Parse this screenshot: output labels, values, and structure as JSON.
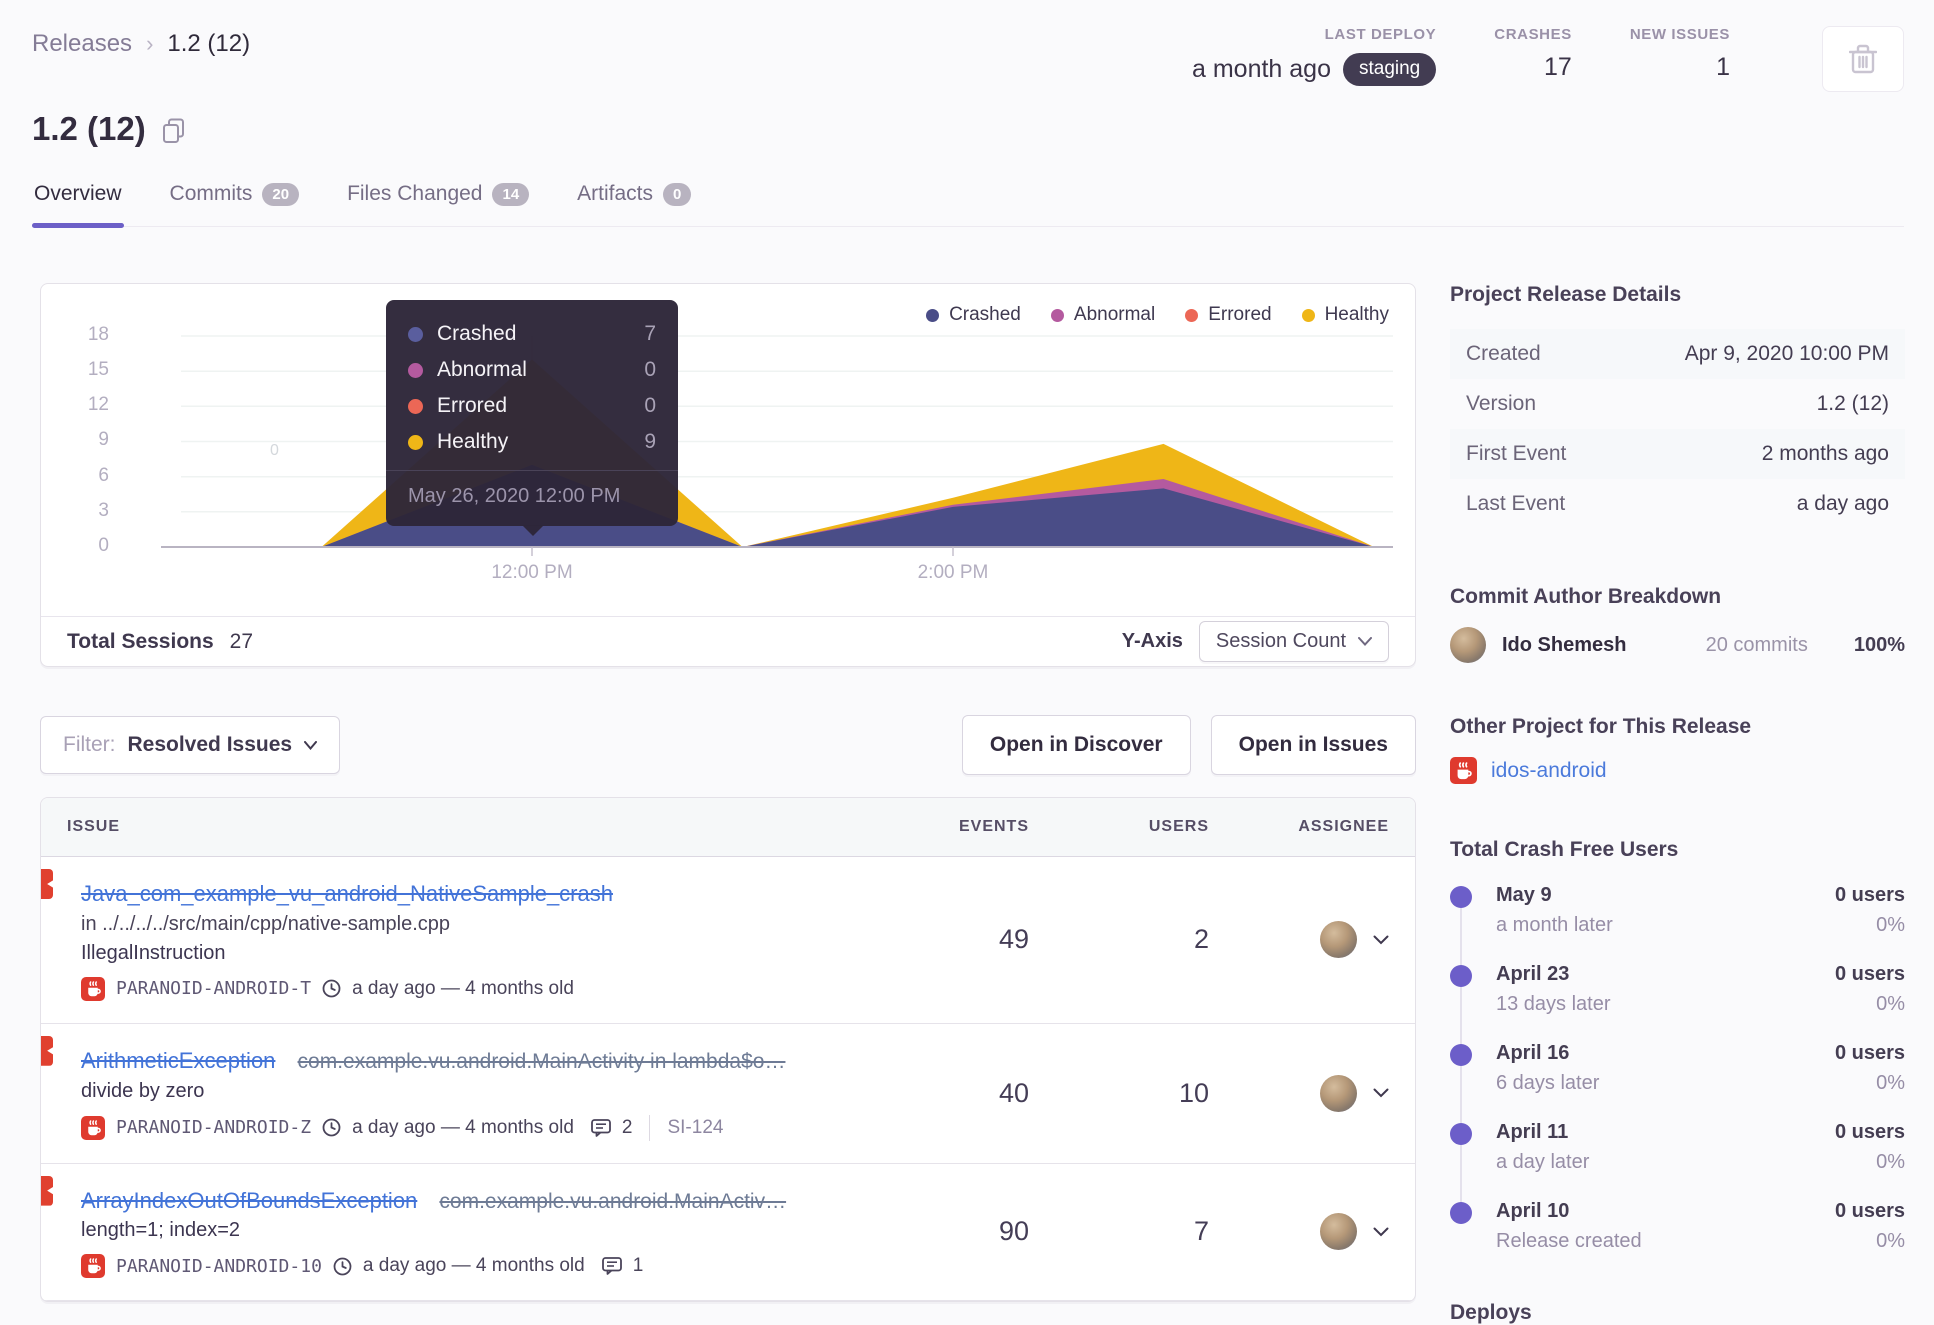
{
  "breadcrumb": {
    "parent": "Releases",
    "current": "1.2 (12)"
  },
  "header": {
    "stats": [
      {
        "label": "LAST DEPLOY",
        "value": "a month ago",
        "badge": "staging"
      },
      {
        "label": "CRASHES",
        "value": "17"
      },
      {
        "label": "NEW ISSUES",
        "value": "1"
      }
    ]
  },
  "release": {
    "title": "1.2 (12)"
  },
  "tabs": [
    {
      "label": "Overview"
    },
    {
      "label": "Commits",
      "badge": "20"
    },
    {
      "label": "Files Changed",
      "badge": "14"
    },
    {
      "label": "Artifacts",
      "badge": "0"
    }
  ],
  "chart": {
    "legend": [
      {
        "label": "Crashed",
        "color": "#4a4d87"
      },
      {
        "label": "Abnormal",
        "color": "#b45a9f"
      },
      {
        "label": "Errored",
        "color": "#ec6756"
      },
      {
        "label": "Healthy",
        "color": "#efb617"
      }
    ],
    "tooltip": {
      "rows": [
        {
          "label": "Crashed",
          "value": "7"
        },
        {
          "label": "Abnormal",
          "value": "0"
        },
        {
          "label": "Errored",
          "value": "0"
        },
        {
          "label": "Healthy",
          "value": "9"
        }
      ],
      "date": "May 26, 2020 12:00 PM"
    },
    "y_ticks": [
      "18",
      "15",
      "12",
      "9",
      "6",
      "3",
      "0"
    ],
    "x_ticks": [
      "12:00 PM",
      "2:00 PM"
    ],
    "stray_label": "0",
    "footer": {
      "total_label": "Total Sessions",
      "total_value": "27",
      "y_axis_label": "Y-Axis",
      "y_axis_value": "Session Count"
    }
  },
  "chart_data": {
    "type": "area",
    "stacked": true,
    "x": [
      "11:00 AM",
      "12:00 PM",
      "1:00 PM",
      "2:00 PM",
      "3:00 PM",
      "4:00 PM"
    ],
    "x_axis_ticks": [
      "12:00 PM",
      "2:00 PM"
    ],
    "series": [
      {
        "name": "Crashed",
        "color": "#4a4d87",
        "values": [
          0,
          7,
          0,
          2,
          5,
          0
        ]
      },
      {
        "name": "Abnormal",
        "color": "#b45a9f",
        "values": [
          0,
          0,
          0,
          0,
          1,
          0
        ]
      },
      {
        "name": "Errored",
        "color": "#ec6756",
        "values": [
          0,
          0,
          0,
          0,
          0,
          0
        ]
      },
      {
        "name": "Healthy",
        "color": "#efb617",
        "values": [
          0,
          9,
          0,
          2,
          3,
          0
        ]
      }
    ],
    "ylim": [
      0,
      18
    ],
    "y_ticks": [
      0,
      3,
      6,
      9,
      12,
      15,
      18
    ],
    "grid": true,
    "legend_position": "top-right",
    "tooltip_point": {
      "date": "May 26, 2020 12:00 PM",
      "Crashed": 7,
      "Abnormal": 0,
      "Errored": 0,
      "Healthy": 9
    },
    "total_sessions": 27,
    "y_axis_setting": "Session Count"
  },
  "toolbar": {
    "filter_label": "Filter:",
    "filter_value": "Resolved Issues",
    "open_discover": "Open in Discover",
    "open_issues": "Open in Issues"
  },
  "issues": {
    "columns": [
      "ISSUE",
      "EVENTS",
      "USERS",
      "ASSIGNEE"
    ],
    "rows": [
      {
        "title": "Java_com_example_vu_android_NativeSample_crash",
        "location": "in ../../../../src/main/cpp/native-sample.cpp",
        "message": "IllegalInstruction",
        "project": "PARANOID-ANDROID-T",
        "age": "a day ago — 4 months old",
        "events": "49",
        "users": "2"
      },
      {
        "title": "ArithmeticException",
        "suffix": "com.example.vu.android.MainActivity in lambda$o…",
        "message": "divide by zero",
        "project": "PARANOID-ANDROID-Z",
        "age": "a day ago — 4 months old",
        "comments": "2",
        "annotation": "SI-124",
        "events": "40",
        "users": "10"
      },
      {
        "title": "ArrayIndexOutOfBoundsException",
        "suffix": "com.example.vu.android.MainActiv…",
        "message": "length=1; index=2",
        "project": "PARANOID-ANDROID-10",
        "age": "a day ago — 4 months old",
        "comments": "1",
        "events": "90",
        "users": "7"
      }
    ]
  },
  "sidebar": {
    "details": {
      "heading": "Project Release Details",
      "rows": [
        {
          "label": "Created",
          "value": "Apr 9, 2020 10:00 PM"
        },
        {
          "label": "Version",
          "value": "1.2 (12)"
        },
        {
          "label": "First Event",
          "value": "2 months ago"
        },
        {
          "label": "Last Event",
          "value": "a day ago"
        }
      ]
    },
    "authors": {
      "heading": "Commit Author Breakdown",
      "name": "Ido Shemesh",
      "commits": "20 commits",
      "percent": "100%"
    },
    "other_project": {
      "heading": "Other Project for This Release",
      "name": "idos-android"
    },
    "crash_free": {
      "heading": "Total Crash Free Users",
      "entries": [
        {
          "date": "May 9",
          "sub": "a month later",
          "users": "0 users",
          "pct": "0%"
        },
        {
          "date": "April 23",
          "sub": "13 days later",
          "users": "0 users",
          "pct": "0%"
        },
        {
          "date": "April 16",
          "sub": "6 days later",
          "users": "0 users",
          "pct": "0%"
        },
        {
          "date": "April 11",
          "sub": "a day later",
          "users": "0 users",
          "pct": "0%"
        },
        {
          "date": "April 10",
          "sub": "Release created",
          "users": "0 users",
          "pct": "0%"
        }
      ]
    },
    "deploys_heading": "Deploys"
  }
}
